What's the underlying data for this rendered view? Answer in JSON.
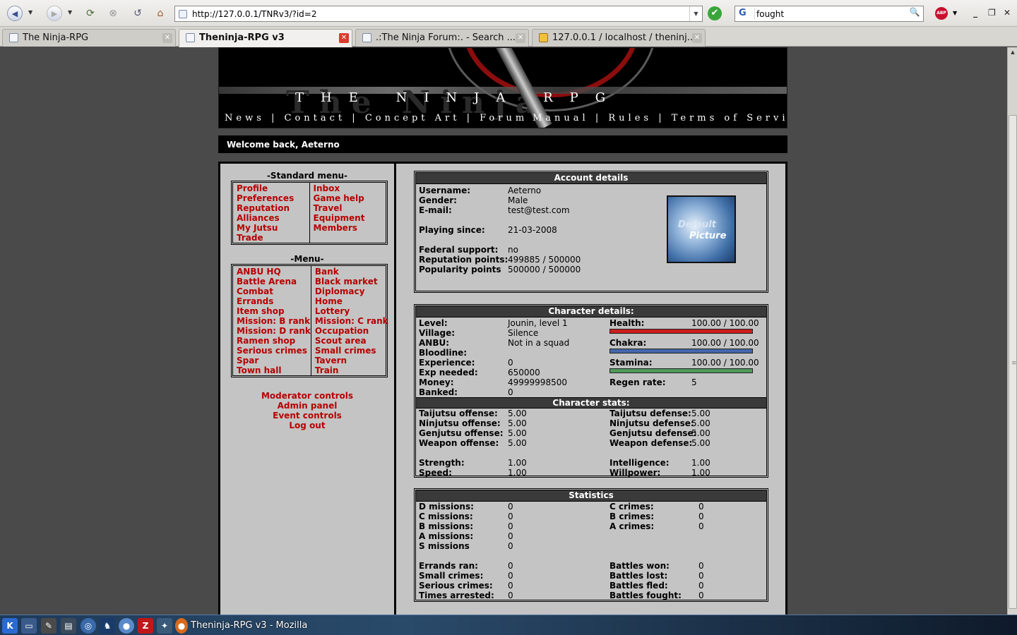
{
  "browser": {
    "url": "http://127.0.0.1/TNRv3/?id=2",
    "search_engine_glyph": "G",
    "search_query": "fought",
    "abp_label": "ABP",
    "tabs": [
      {
        "label": "The Ninja-RPG",
        "active": false
      },
      {
        "label": "Theninja-RPG v3",
        "active": true
      },
      {
        "label": ".:The Ninja Forum:. - Search ...",
        "active": false
      },
      {
        "label": "127.0.0.1 / localhost / theninj...",
        "active": false
      }
    ]
  },
  "banner": {
    "title": "THE NINJA RPG",
    "ghost_title": "The Ninja",
    "nav_left": [
      "News",
      "Contact",
      "Concept Art",
      "Forum"
    ],
    "nav_right": [
      "Manual",
      "Rules",
      "Terms of Service"
    ]
  },
  "welcome": "Welcome back, Aeterno",
  "standard_menu": {
    "title": "-Standard menu-",
    "left": [
      "Profile",
      "Preferences",
      "Reputation",
      "Alliances",
      "My Jutsu",
      "Trade"
    ],
    "right": [
      "Inbox",
      "Game help",
      "Travel",
      "Equipment",
      "Members"
    ]
  },
  "menu": {
    "title": "-Menu-",
    "left": [
      "ANBU HQ",
      "Battle Arena",
      "Combat",
      "Errands",
      "Item shop",
      "Mission: B rank",
      "Mission: D rank",
      "Ramen shop",
      "Serious crimes",
      "Spar",
      "Town hall"
    ],
    "right": [
      "Bank",
      "Black market",
      "Diplomacy",
      "Home",
      "Lottery",
      "Mission: C rank",
      "Occupation",
      "Scout area",
      "Small crimes",
      "Tavern",
      "Train"
    ]
  },
  "admin_links": [
    "Moderator controls",
    "Admin panel",
    "Event controls",
    "Log out"
  ],
  "account": {
    "title": "Account details",
    "labels": {
      "username": "Username:",
      "gender": "Gender:",
      "email": "E-mail:",
      "playing_since": "Playing since:",
      "federal": "Federal support:",
      "reputation": "Reputation points:",
      "popularity": "Popularity points"
    },
    "values": {
      "username": "Aeterno",
      "gender": "Male",
      "email": "test@test.com",
      "playing_since": "21-03-2008",
      "federal": "no",
      "reputation": "499885 / 500000",
      "popularity": "500000 / 500000"
    },
    "avatar_text": [
      "Default",
      "Picture"
    ]
  },
  "character": {
    "title": "Character details:",
    "labels": {
      "level": "Level:",
      "village": "Village:",
      "anbu": "ANBU:",
      "bloodline": "Bloodline:",
      "experience": "Experience:",
      "exp_needed": "Exp needed:",
      "money": "Money:",
      "banked": "Banked:",
      "health": "Health:",
      "chakra": "Chakra:",
      "stamina": "Stamina:",
      "regen": "Regen rate:"
    },
    "values": {
      "level": "Jounin, level 1",
      "village": "Silence",
      "anbu": "Not in a squad",
      "bloodline": "",
      "experience": "0",
      "exp_needed": "650000",
      "money": "49999998500",
      "banked": "0",
      "health": "100.00 / 100.00",
      "chakra": "100.00 / 100.00",
      "stamina": "100.00 / 100.00",
      "regen": "5"
    },
    "bars": {
      "health_fraction": 1.0,
      "chakra_fraction": 1.0,
      "stamina_fraction": 1.0,
      "health_color": "#cc1d1d",
      "chakra_color": "#4467a8",
      "stamina_color": "#4f9a5a"
    }
  },
  "stats": {
    "title": "Character stats:",
    "labels": {
      "tai_off": "Taijutsu offense:",
      "nin_off": "Ninjutsu offense:",
      "gen_off": "Genjutsu offense:",
      "wep_off": "Weapon offense:",
      "strength": "Strength:",
      "speed": "Speed:",
      "tai_def": "Taijutsu defense:",
      "nin_def": "Ninjutsu defense:",
      "gen_def": "Genjutsu defense:",
      "wep_def": "Weapon defense:",
      "intelligence": "Intelligence:",
      "willpower": "Willpower:"
    },
    "values": {
      "tai_off": "5.00",
      "nin_off": "5.00",
      "gen_off": "5.00",
      "wep_off": "5.00",
      "strength": "1.00",
      "speed": "1.00",
      "tai_def": "5.00",
      "nin_def": "5.00",
      "gen_def": "5.00",
      "wep_def": "5.00",
      "intelligence": "1.00",
      "willpower": "1.00"
    }
  },
  "statistics": {
    "title": "Statistics",
    "labels": {
      "d_missions": "D missions:",
      "c_missions": "C missions:",
      "b_missions": "B missions:",
      "a_missions": "A missions:",
      "s_missions": "S missions",
      "errands": "Errands ran:",
      "small_crimes": "Small crimes:",
      "serious_crimes": "Serious crimes:",
      "arrested": "Times arrested:",
      "c_crimes": "C crimes:",
      "b_crimes": "B crimes:",
      "a_crimes": "A crimes:",
      "won": "Battles won:",
      "lost": "Battles lost:",
      "fled": "Battles fled:",
      "fought": "Battles fought:"
    },
    "values": {
      "d_missions": "0",
      "c_missions": "0",
      "b_missions": "0",
      "a_missions": "0",
      "s_missions": "0",
      "errands": "0",
      "small_crimes": "0",
      "serious_crimes": "0",
      "arrested": "0",
      "c_crimes": "0",
      "b_crimes": "0",
      "a_crimes": "0",
      "won": "0",
      "lost": "0",
      "fled": "0",
      "fought": "0"
    }
  },
  "taskbar": {
    "window_title": "Theninja-RPG v3 - Mozilla"
  }
}
